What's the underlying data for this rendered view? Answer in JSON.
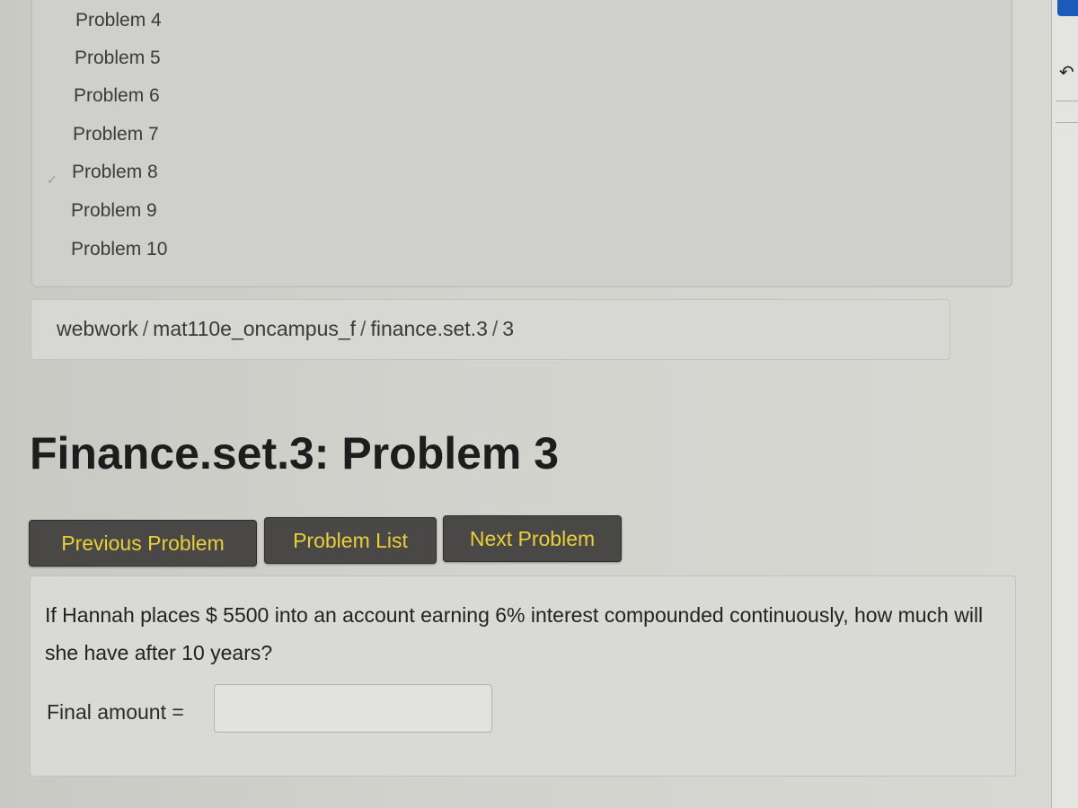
{
  "problem_list": {
    "items": [
      {
        "label": "Problem 4",
        "completed": false
      },
      {
        "label": "Problem 5",
        "completed": false
      },
      {
        "label": "Problem 6",
        "completed": false
      },
      {
        "label": "Problem 7",
        "completed": false
      },
      {
        "label": "Problem 8",
        "completed": true
      },
      {
        "label": "Problem 9",
        "completed": false
      },
      {
        "label": "Problem 10",
        "completed": false
      }
    ]
  },
  "breadcrumb": {
    "items": [
      "webwork",
      "mat110e_oncampus_f",
      "finance.set.3",
      "3"
    ],
    "separator": "/"
  },
  "page_title": "Finance.set.3: Problem 3",
  "navigation": {
    "previous_label": "Previous Problem",
    "list_label": "Problem List",
    "next_label": "Next Problem"
  },
  "problem": {
    "text": "If Hannah places $ 5500 into an account earning 6% interest compounded continuously, how much will she have after 10 years?",
    "answer_label": "Final amount =",
    "answer_value": "",
    "answer_placeholder": ""
  },
  "icons": {
    "check": "✓",
    "undo": "↶"
  },
  "colors": {
    "button_bg": "#4a4846",
    "button_text": "#e8cf3a",
    "title": "#1d1d1d"
  }
}
